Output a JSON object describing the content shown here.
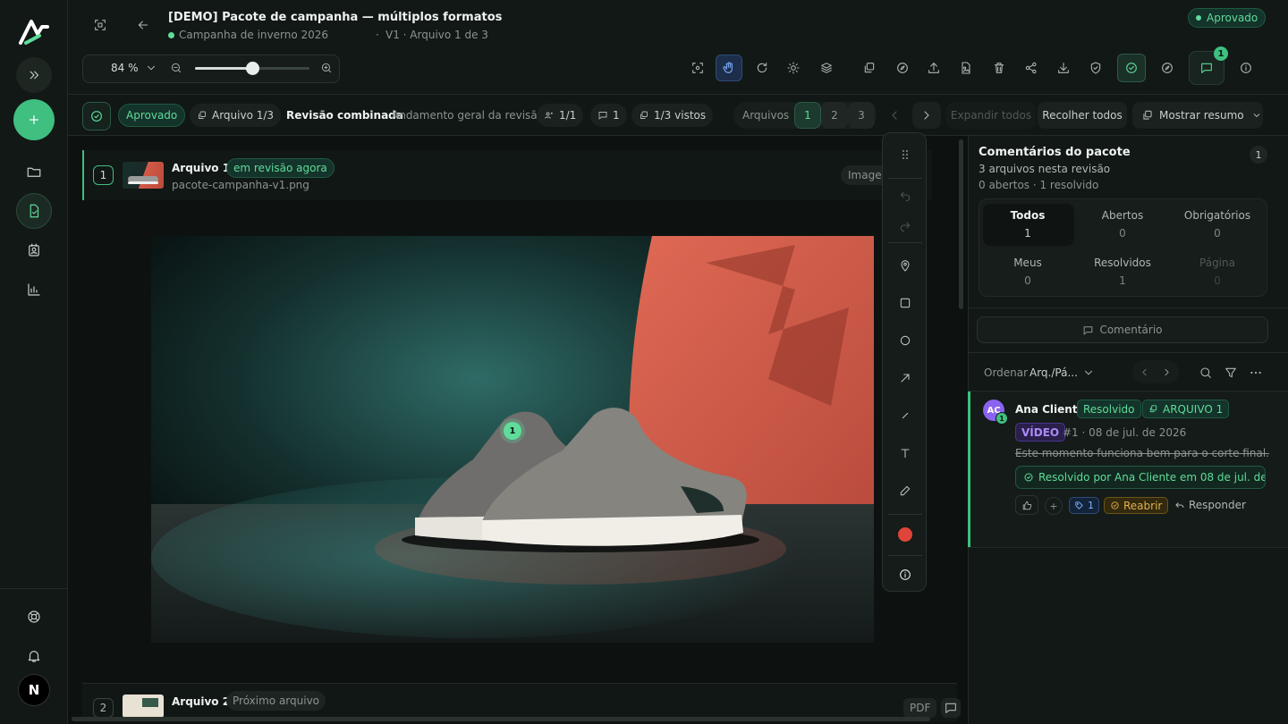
{
  "header": {
    "title": "[DEMO] Pacote de campanha — múltiplos formatos",
    "campaign": "Campanha de inverno 2026",
    "version_info": "V1 · Arquivo 1 de 3",
    "status_badge": "Aprovado",
    "zoom_value": "84 %",
    "zoom_percent": 0.5,
    "comments_count": "1"
  },
  "review_bar": {
    "status": "Aprovado",
    "file_chip": "Arquivo 1/3",
    "title": "Revisão combinada",
    "subtitle": "Andamento geral da revisão",
    "reviewers": "1/1",
    "comments": "1",
    "views": "1/3 vistos",
    "files_label": "Arquivos",
    "file_tabs": [
      "1",
      "2",
      "3"
    ],
    "expand_all": "Expandir todos",
    "collapse_all": "Recolher todos",
    "show_summary": "Mostrar resumo"
  },
  "file1": {
    "index": "1",
    "name": "Arquivo 1",
    "badge": "em revisão agora",
    "filename": "pacote-campanha-v1.png",
    "type_label": "Imagem",
    "marker": "1"
  },
  "file2": {
    "index": "2",
    "name": "Arquivo 2",
    "badge": "Próximo arquivo",
    "type_label": "PDF"
  },
  "panel": {
    "title": "Comentários do pacote",
    "count": "1",
    "subtitle": "3 arquivos nesta revisão",
    "stats": "0 abertos · 1 resolvido",
    "filters": [
      {
        "label": "Todos",
        "count": "1"
      },
      {
        "label": "Abertos",
        "count": "0"
      },
      {
        "label": "Obrigatórios",
        "count": "0"
      },
      {
        "label": "Meus",
        "count": "0"
      },
      {
        "label": "Resolvidos",
        "count": "1"
      },
      {
        "label": "Página",
        "count": "0"
      }
    ],
    "comment_button": "Comentário",
    "sort_label": "Ordenar",
    "sort_value": "Arq./Pá...",
    "comment": {
      "avatar_initials": "AC",
      "avatar_badge": "1",
      "author": "Ana Cliente",
      "status": "Resolvido",
      "file_tag": "ARQUIVO 1",
      "media_tag": "VÍDEO",
      "meta": "#1 · 08 de jul. de 2026",
      "text": "Este momento funciona bem para o corte final.",
      "resolved_note": "Resolvido por Ana Cliente em 08 de jul. de ...",
      "plus": "+",
      "tag_count": "1",
      "reopen": "Reabrir",
      "reply": "Responder"
    }
  },
  "rail": {
    "user_initial": "N"
  },
  "colors": {
    "accent": "#5fdc9a",
    "bg": "#0f1412",
    "warn": "#e0b04a",
    "purple": "#8a63f0"
  }
}
